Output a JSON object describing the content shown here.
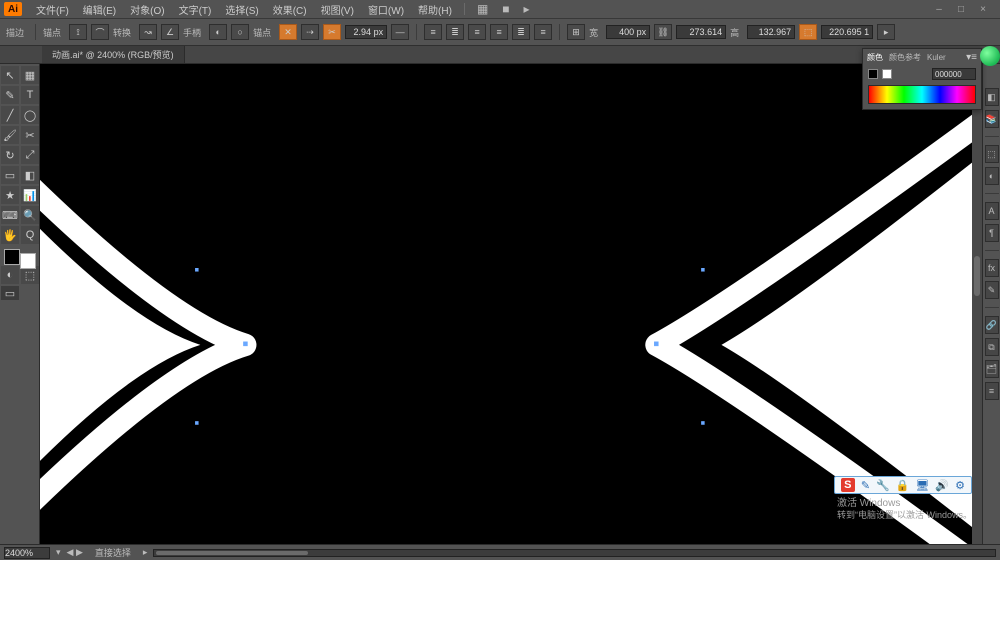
{
  "app_icon": "Ai",
  "menus": [
    "文件(F)",
    "编辑(E)",
    "对象(O)",
    "文字(T)",
    "选择(S)",
    "效果(C)",
    "视图(V)",
    "窗口(W)",
    "帮助(H)"
  ],
  "toolbar_extras": [
    "▦",
    "■",
    "▸"
  ],
  "window_controls": [
    "–",
    "□",
    "×"
  ],
  "options": {
    "row1_left_label": "描边",
    "row2": {
      "labels": [
        "锚点",
        "转换",
        "手柄",
        "锚点"
      ],
      "stroke_input": "2.94 px",
      "w_label": "宽",
      "w_value": "400 px",
      "mid_value": "273.614",
      "h_label": "高",
      "h_value": "132.967",
      "coord_value": "220.695 1"
    }
  },
  "document_tab": "动画.ai* @ 2400% (RGB/预览)",
  "toolbox_tools": [
    "↖",
    "▦",
    "✎",
    "T",
    "╱",
    "◯",
    "🖌",
    "✂",
    "↻",
    "⤢",
    "▭",
    "◧",
    "★",
    "📊",
    "⌨",
    "🔍",
    "🖐",
    "Q",
    "◐",
    "⬚"
  ],
  "swatch": {
    "fill": "#000000",
    "stroke": "#ffffff"
  },
  "color_panel": {
    "tabs": [
      "颜色",
      "颜色参考",
      "Kuler"
    ],
    "fill": "#000000",
    "stroke": "#ffffff",
    "hex": "000000"
  },
  "right_strip": [
    "◧",
    "📚",
    "⬚",
    "◐",
    "A",
    "¶",
    "fx",
    "✎",
    "🔗",
    "⧉",
    "🗂",
    "≡"
  ],
  "system_tray": {
    "icons": [
      "S",
      "✎",
      "🔧",
      "🔒",
      "🖥",
      "🔊",
      "⚙"
    ],
    "badge_color": "#e33b2e"
  },
  "activation": {
    "title": "激活 Windows",
    "sub": "转到“电脑设置”以激活 Windows。"
  },
  "statusbar": {
    "zoom": "2400%",
    "nav": "◀ ▶",
    "selection_label": "直接选择"
  },
  "chart_data": null
}
